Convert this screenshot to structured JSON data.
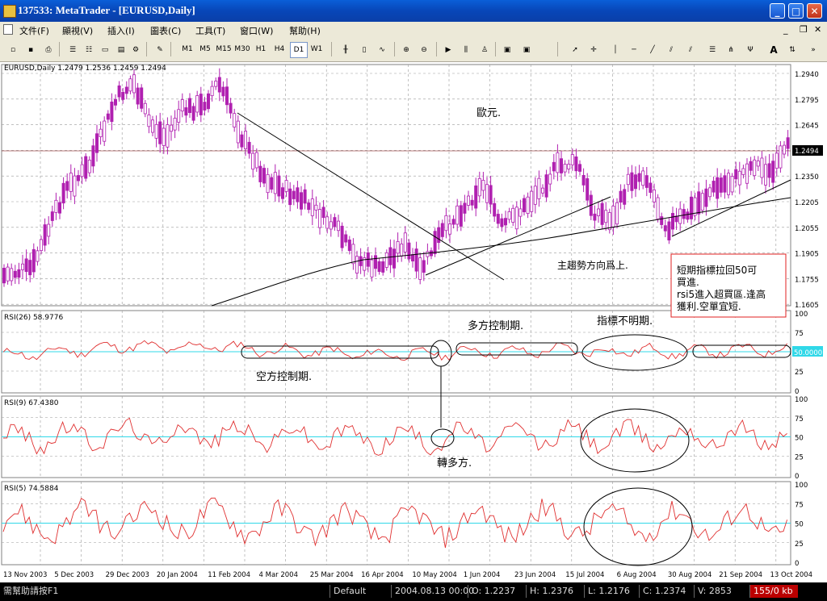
{
  "window": {
    "title": "137533: MetaTrader - [EURUSD,Daily]"
  },
  "menu": [
    "文件(F)",
    "顯視(V)",
    "插入(I)",
    "圖表(C)",
    "工具(T)",
    "窗口(W)",
    "幫助(H)"
  ],
  "toolbar": {
    "timeframes": [
      "M1",
      "M5",
      "M15",
      "M30",
      "H1",
      "H4",
      "D1",
      "W1"
    ],
    "active_timeframe": "D1",
    "text_tool": "A"
  },
  "chart": {
    "symbol_info": "EURUSD,Daily  1.2479 1.2536 1.2459 1.2494",
    "price_badge": "1.2494",
    "price_axis": [
      "1.2940",
      "1.2795",
      "1.2645",
      "1.2500",
      "1.2350",
      "1.2205",
      "1.2055",
      "1.1905",
      "1.1755",
      "1.1605"
    ],
    "date_axis": [
      "13 Nov 2003",
      "5 Dec 2003",
      "29 Dec 2003",
      "20 Jan 2004",
      "11 Feb 2004",
      "4 Mar 2004",
      "25 Mar 2004",
      "16 Apr 2004",
      "10 May 2004",
      "1 Jun 2004",
      "23 Jun 2004",
      "15 Jul 2004",
      "6 Aug 2004",
      "30 Aug 2004",
      "21 Sep 2004",
      "13 Oct 2004"
    ],
    "annotations": {
      "euro": "歐元.",
      "trend": "主趨勢方向爲上.",
      "note_line1": "短期指標拉回50可",
      "note_line2": "買進.",
      "note_line3": "rsi5進入超買區.逢高",
      "note_line4": "獲利.空單宜短."
    },
    "colors": {
      "candles": "#b020b0",
      "rsi": "#e03030",
      "midline": "#30d8e8",
      "note_border": "#e02020"
    }
  },
  "indicators": [
    {
      "label": "RSI(26)  58.9776",
      "levels": [
        "100",
        "75",
        "50",
        "25",
        "0"
      ],
      "mid_badge": "50.0000",
      "notes": {
        "bear": "空方控制期.",
        "bull": "多方控制期.",
        "unclear": "指標不明期."
      }
    },
    {
      "label": "RSI(9)  67.4380",
      "levels": [
        "100",
        "75",
        "50",
        "25",
        "0"
      ],
      "notes": {
        "turn": "轉多方."
      }
    },
    {
      "label": "RSI(5)  74.5884",
      "levels": [
        "100",
        "75",
        "50",
        "25",
        "0"
      ]
    }
  ],
  "status": {
    "help": "需幫助請按F1",
    "profile": "Default",
    "datetime": "2004.08.13 00:00",
    "open": "O: 1.2237",
    "high": "H: 1.2376",
    "low": "L: 1.2176",
    "close": "C: 1.2374",
    "volume": "V: 2853",
    "traffic": "155/0 kb"
  }
}
